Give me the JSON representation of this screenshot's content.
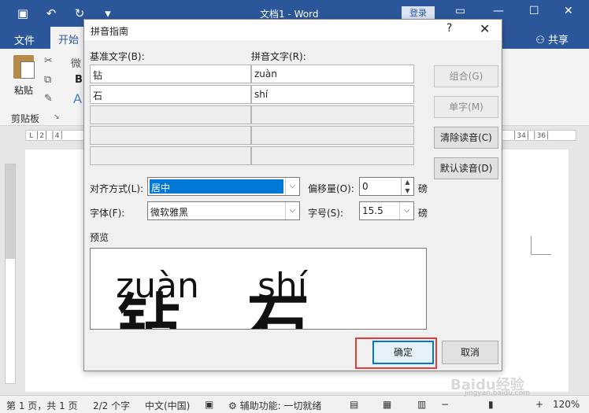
{
  "word": {
    "title": "文档1 - Word",
    "login": "登录",
    "tabs": [
      "文件",
      "开始"
    ],
    "share": "共享",
    "paste": "粘贴",
    "clipboard": "剪贴板",
    "font_box": "微",
    "bold": "B",
    "ruler_left": "L │2│ │4│",
    "ruler_right": "│34│ │36│"
  },
  "statusbar": {
    "page": "第 1 页，共 1 页",
    "words": "2/2 个字",
    "lang": "中文(中国)",
    "accessibility": "辅助功能: 一切就绪",
    "zoom": "120%",
    "watermark": "Baidu经验",
    "watermark_url": "jingyan.baidu.com"
  },
  "dialog": {
    "title": "拼音指南",
    "help": "?",
    "base_label": "基准文字(B):",
    "pinyin_label": "拼音文字(R):",
    "rows": [
      {
        "base": "钻",
        "pinyin": "zuàn"
      },
      {
        "base": "石",
        "pinyin": "shí"
      }
    ],
    "buttons": {
      "group": "组合(G)",
      "single": "单字(M)",
      "clear": "清除读音(C)",
      "default": "默认读音(D)",
      "ok": "确定",
      "cancel": "取消"
    },
    "align_label": "对齐方式(L):",
    "align_value": "居中",
    "offset_label": "偏移量(O):",
    "offset_value": "0",
    "offset_unit": "磅",
    "font_label": "字体(F):",
    "font_value": "微软雅黑",
    "size_label": "字号(S):",
    "size_value": "15.5",
    "size_unit": "磅",
    "preview_label": "预览",
    "preview_pinyin": [
      "zuàn",
      "shí"
    ],
    "preview_base": [
      "钻",
      "石"
    ]
  }
}
